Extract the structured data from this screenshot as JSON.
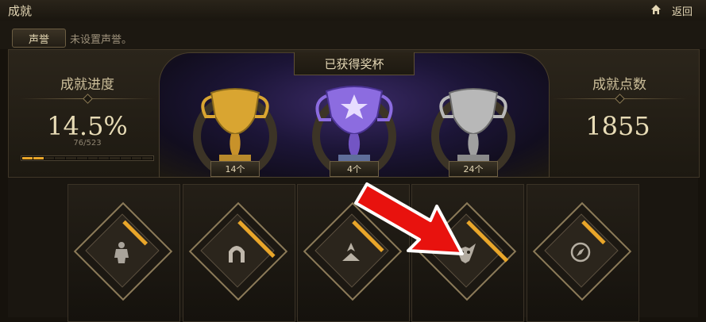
{
  "window": {
    "title": "成就",
    "back_label": "返回",
    "home_icon": "home-icon"
  },
  "reputation": {
    "button_label": "声誉",
    "status_text": "未设置声誉。"
  },
  "progress": {
    "title": "成就进度",
    "percent": "14.5%",
    "count": "76/523",
    "fraction": 0.145
  },
  "trophies": {
    "title": "已获得奖杯",
    "items": [
      {
        "name": "gold-trophy",
        "count": "14个",
        "color": "#d9a531"
      },
      {
        "name": "purple-trophy",
        "count": "4个",
        "color": "#8c6ce0"
      },
      {
        "name": "silver-trophy",
        "count": "24个",
        "color": "#b8b8b8"
      }
    ]
  },
  "points": {
    "title": "成就点数",
    "value": "1855"
  },
  "categories": [
    {
      "icon": "body-icon"
    },
    {
      "icon": "gate-icon"
    },
    {
      "icon": "emblem-icon"
    },
    {
      "icon": "demon-mask-icon"
    },
    {
      "icon": "compass-icon"
    }
  ],
  "colors": {
    "accent": "#e9a62a",
    "text_gold": "#e3d6b4"
  }
}
